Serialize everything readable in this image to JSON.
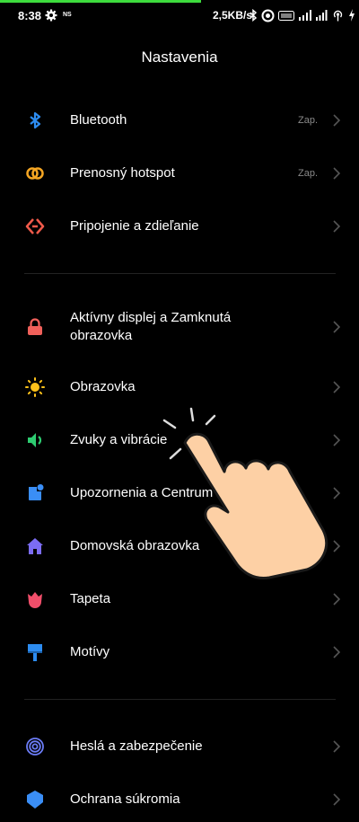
{
  "status_bar": {
    "time": "8:38",
    "ns_label": "NS",
    "net_speed": "2,5KB/s",
    "icons": [
      "settings-icon",
      "bluetooth-icon",
      "circle-icon",
      "volte-icon",
      "5g-signal-icon",
      "signal-icon",
      "hotspot-icon",
      "charging-icon"
    ]
  },
  "header": {
    "title": "Nastavenia"
  },
  "colors": {
    "background": "#000000",
    "divider": "#222222",
    "bluetooth": "#2d8cf0",
    "hotspot": "#f5a623",
    "connection": "#f05a4a",
    "lock": "#f0605a",
    "display": "#ffc21a",
    "sound": "#2ecc71",
    "notifications": "#3a8ef6",
    "home": "#7b6cf2",
    "wallpaper": "#f04e6a",
    "themes": "#2d8cf0",
    "security": "#6b7cf6",
    "progress": "#3ddc3d"
  },
  "groups": [
    {
      "items": [
        {
          "label": "Bluetooth",
          "value": "Zap.",
          "icon": "bluetooth-icon"
        },
        {
          "label": "Prenosný hotspot",
          "value": "Zap.",
          "icon": "hotspot-icon"
        },
        {
          "label": "Pripojenie a zdieľanie",
          "value": "",
          "icon": "connection-sharing-icon"
        }
      ]
    },
    {
      "items": [
        {
          "label": "Aktívny displej a Zamknutá obrazovka",
          "value": "",
          "icon": "lock-icon"
        },
        {
          "label": "Obrazovka",
          "value": "",
          "icon": "sun-icon"
        },
        {
          "label": "Zvuky a vibrácie",
          "value": "",
          "icon": "speaker-icon"
        },
        {
          "label": "Upozornenia a Centrum",
          "value": "",
          "icon": "notification-icon"
        },
        {
          "label": "Domovská obrazovka",
          "value": "",
          "icon": "home-icon"
        },
        {
          "label": "Tapeta",
          "value": "",
          "icon": "tulip-icon"
        },
        {
          "label": "Motívy",
          "value": "",
          "icon": "paint-roller-icon"
        }
      ]
    },
    {
      "items": [
        {
          "label": "Heslá a zabezpečenie",
          "value": "",
          "icon": "fingerprint-icon"
        },
        {
          "label": "Ochrana súkromia",
          "value": "",
          "icon": "privacy-shield-icon"
        }
      ]
    }
  ],
  "overlay": {
    "icon": "tap-hand-icon"
  }
}
